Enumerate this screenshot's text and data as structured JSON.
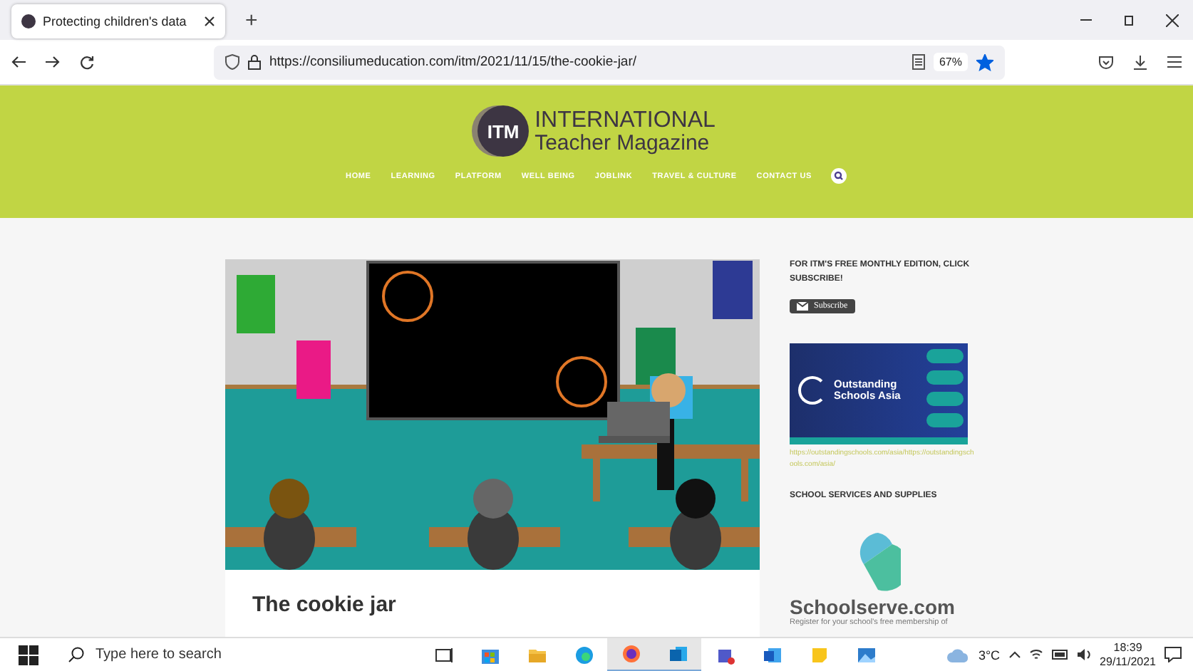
{
  "browser": {
    "tabs": [
      {
        "title": "Protecting children's data",
        "selected": true
      }
    ],
    "new_tab": "+",
    "url": "https://consiliumeducation.com/itm/2021/11/15/the-cookie-jar/",
    "zoom": "67%",
    "bookmarked": true
  },
  "site": {
    "logo": {
      "mark": "ITM",
      "line1": "INTERNATIONAL",
      "line2": "Teacher Magazine"
    },
    "nav": [
      "HOME",
      "LEARNING",
      "PLATFORM",
      "WELL BEING",
      "JOBLINK",
      "TRAVEL & CULTURE",
      "CONTACT US"
    ]
  },
  "article": {
    "title": "The cookie jar"
  },
  "sidebar": {
    "subscribe_heading": "FOR ITM'S FREE MONTHLY EDITION, CLICK SUBSCRIBE!",
    "subscribe_button": "Subscribe",
    "ad": {
      "line1": "Outstanding",
      "line2": "Schools Asia"
    },
    "ad_link": "https://outstandingschools.com/asia/https://outstandingschools.com/asia/",
    "services_heading": "SCHOOL SERVICES AND SUPPLIES",
    "brand": "Schoolserve.com",
    "blurb": "Register for your school's free membership of"
  },
  "taskbar": {
    "search_placeholder": "Type here to search",
    "apps": [
      {
        "kind": "taskview",
        "selected": false
      },
      {
        "kind": "store",
        "selected": false
      },
      {
        "kind": "folder",
        "selected": false
      },
      {
        "kind": "edge",
        "selected": false
      },
      {
        "kind": "firefox",
        "selected": true
      },
      {
        "kind": "outlook",
        "selected": true
      },
      {
        "kind": "teams",
        "selected": false
      },
      {
        "kind": "word",
        "selected": false
      },
      {
        "kind": "notes",
        "selected": false
      },
      {
        "kind": "photos",
        "selected": false
      }
    ],
    "weather": "3°C",
    "time": "18:39",
    "date": "29/11/2021"
  }
}
